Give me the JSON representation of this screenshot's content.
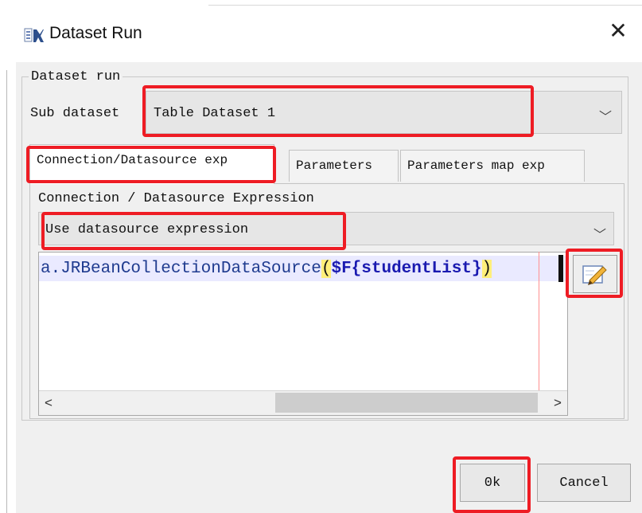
{
  "window": {
    "title": "Dataset Run",
    "close_glyph": "✕"
  },
  "fieldset": {
    "legend": "Dataset run"
  },
  "sub_dataset": {
    "label": "Sub dataset",
    "value": "Table Dataset 1"
  },
  "tabs": [
    {
      "label": "Connection/Datasource exp",
      "active": true
    },
    {
      "label": "Parameters",
      "active": false
    },
    {
      "label": "Parameters map exp",
      "active": false
    }
  ],
  "connection": {
    "section_label": "Connection / Datasource Expression",
    "mode_value": "Use datasource expression",
    "expression": {
      "prefix": "a.JRBeanCollectionDataSource",
      "open_paren": "(",
      "field": "$F{studentList}",
      "close_paren": ")"
    }
  },
  "scrollbar": {
    "left_glyph": "<",
    "right_glyph": ">"
  },
  "combo_arrow": "﹀",
  "buttons": {
    "ok": "0k",
    "cancel": "Cancel"
  },
  "icons": {
    "app": "report-designer-icon",
    "edit_expression": "pencil-note-icon"
  },
  "colors": {
    "annotation": "#ee1c24",
    "highlight_line": "#eaeaff",
    "paren_highlight": "#ffef7a"
  }
}
